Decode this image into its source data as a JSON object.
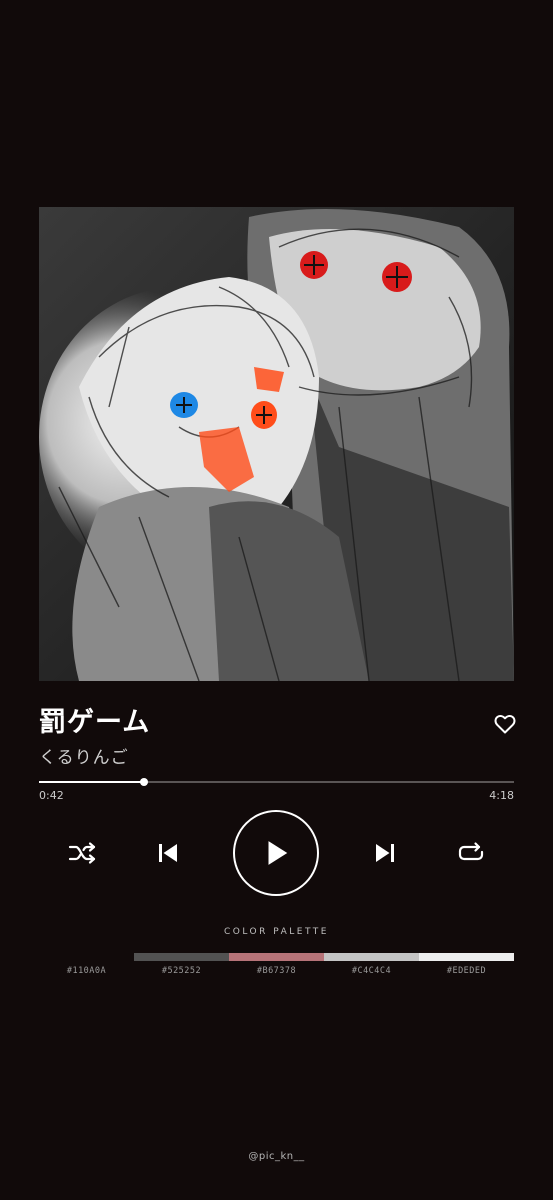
{
  "track": {
    "title": "罰ゲーム",
    "artist": "くるりんご",
    "liked": false
  },
  "playback": {
    "elapsed": "0:42",
    "total": "4:18",
    "progress_fraction": 0.22,
    "state": "paused"
  },
  "controls": {
    "shuffle_icon": "shuffle-icon",
    "prev_icon": "skip-previous-icon",
    "play_icon": "play-icon",
    "next_icon": "skip-next-icon",
    "repeat_icon": "repeat-icon",
    "like_icon": "heart-outline-icon"
  },
  "palette": {
    "title": "COLOR PALETTE",
    "colors": [
      {
        "hex": "#110A0A",
        "label": "#110A0A"
      },
      {
        "hex": "#525252",
        "label": "#525252"
      },
      {
        "hex": "#B67378",
        "label": "#B67378"
      },
      {
        "hex": "#C4C4C4",
        "label": "#C4C4C4"
      },
      {
        "hex": "#EDEDED",
        "label": "#EDEDED"
      }
    ]
  },
  "credit": "@pic_kn__",
  "colors": {
    "background": "#110a0a",
    "accent": "#ffffff",
    "track": "#5a5555"
  }
}
